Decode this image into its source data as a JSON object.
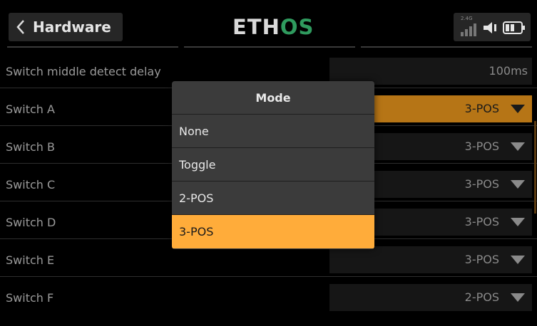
{
  "header": {
    "back_title": "Hardware",
    "logo_part1": "ETH",
    "logo_part2": "OS",
    "radio_label": "2.4G"
  },
  "rows": [
    {
      "label": "Switch middle detect delay",
      "value": "100ms"
    },
    {
      "label": "Switch A",
      "value": "3-POS"
    },
    {
      "label": "Switch B",
      "value": "3-POS"
    },
    {
      "label": "Switch C",
      "value": "3-POS"
    },
    {
      "label": "Switch D",
      "value": "3-POS"
    },
    {
      "label": "Switch E",
      "value": "3-POS"
    },
    {
      "label": "Switch F",
      "value": "2-POS"
    }
  ],
  "popup": {
    "title": "Mode",
    "options": [
      "None",
      "Toggle",
      "2-POS",
      "3-POS"
    ],
    "selected": "3-POS"
  },
  "colors": {
    "accent": "#ffac3a",
    "active_row": "#b67516",
    "logo_green": "#2f9a5e"
  }
}
